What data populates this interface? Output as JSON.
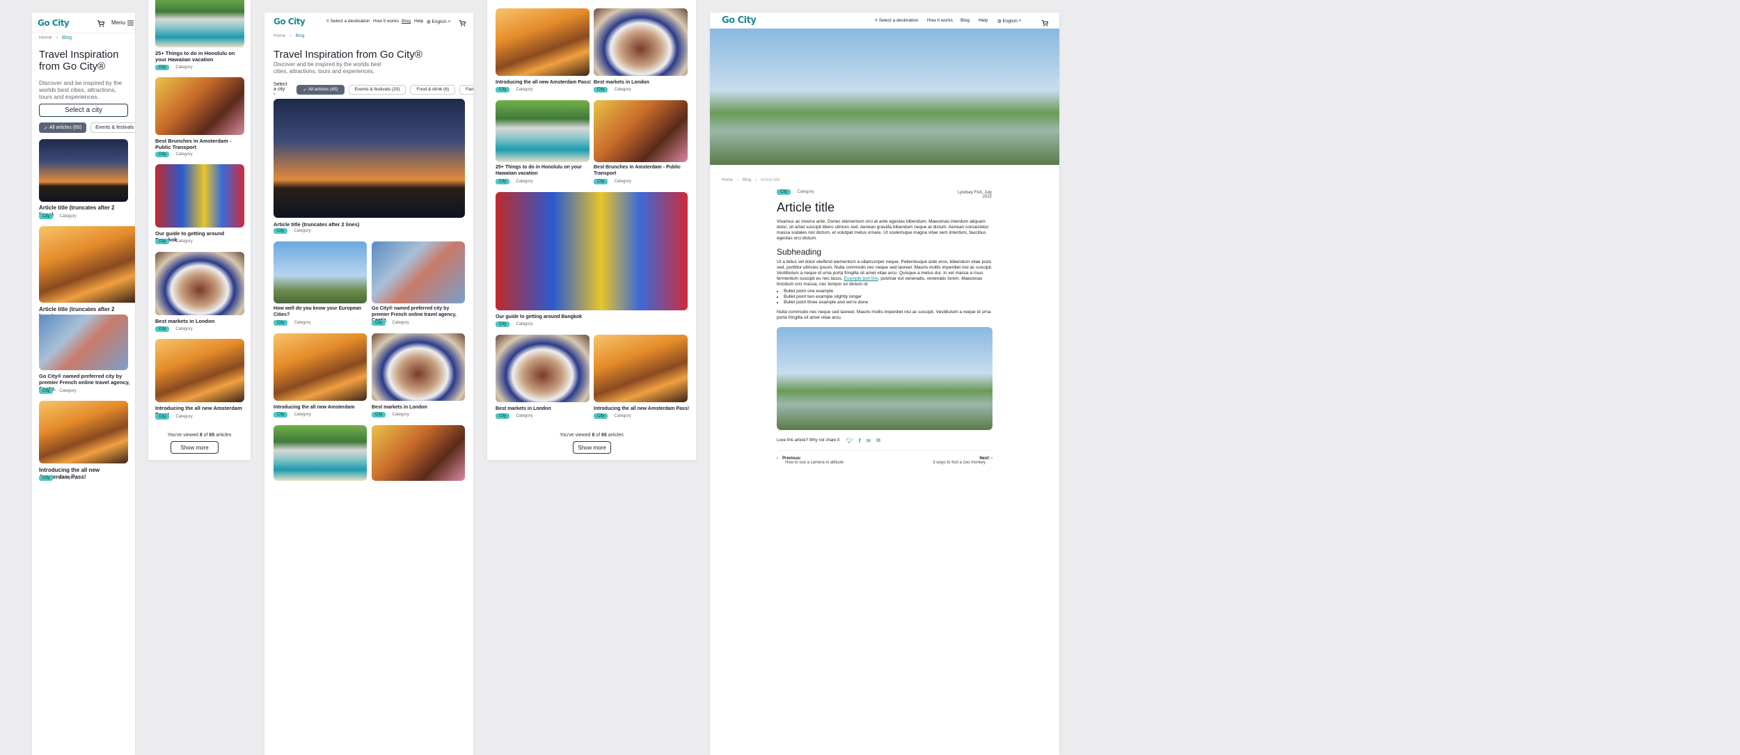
{
  "brand": "Go City",
  "nav": {
    "menu": "Menu",
    "destination": "Select a destination",
    "how": "How it works",
    "blog": "Blog",
    "help": "Help",
    "lang": "English"
  },
  "crumb": {
    "home": "Home",
    "blog": "Blog",
    "article": "Article title"
  },
  "listing": {
    "title": "Travel Inspiration from Go City®",
    "subtitle": "Discover and be inspired by the worlds best cities, attractions, tours and experiences.",
    "select_city": "Select a city",
    "select_city_short": "Select a city"
  },
  "filters": {
    "all": "All articles (65)",
    "events": "Events & festivals (20)",
    "food": "Food & drink (6)",
    "family": "Family frie"
  },
  "tag": {
    "city": "City",
    "category": "Category"
  },
  "cards": {
    "article": "Article title (truncates after 2 lines)",
    "honolulu": "25+ Things to do in Honolulu on your Hawaiian vacation",
    "brunch": "Best Brunches in Amsterdam - Public Transport",
    "bangkok": "Our guide to getting around Bangkok",
    "london": "Best markets in London",
    "amsterdam": "Introducing the all new Amsterdam Pass!",
    "ceetiz": "Go City® named preferred city by premier French online travel agency, Ceetiz.",
    "european": "How well do you know your European Cities?"
  },
  "pager": {
    "pre": "You've viewed",
    "shown": "8",
    "of": "of",
    "total": "65",
    "post": "articles",
    "show_more": "Show more"
  },
  "article": {
    "author": "Lyndsey Fish, July 2022",
    "title": "Article title",
    "p1": "Vivamus ac viverra ante. Donec elementum orci at ante egestas bibendum. Maecenas interdum aliquam dolor, sit amet suscipit libero ultrices sed. Aenean gravida bibendum neque at dictum. Aenean consectetur massa sodales nisl dictum, et volutpat metus ornare. Ut scelerisque magna vitae sem interdum, faucibus egestas orci dictum.",
    "subheading": "Subheading",
    "p2a": "Ut a tellus vel dolor eleifend elementum a ullamcorper neque. Pellentesque ante eros, bibendum vitae justo sed, porttitor ultricies ipsum. Nulla commodo nec neque sed laoreet. Mauris mollis imperdiet nisl ac suscipit. Vestibulum a neque id urna porta fringilla sit amet vitae arcu. Quisque a metus dui. In vel massa a risus fermentum suscipit eu nec lacus.",
    "link": "Example text link",
    "p2b": ", pulvinar est venenatis, venenatis lorem. Maecenas tincidunt orci massa, nec tempor ex dictum id.",
    "bullets": [
      "Bullet point one example",
      "Bullet point two example slightly longer",
      "Bullet point three example and we're done"
    ],
    "p3": "Nulla commodo nec neque sed laoreet. Mauris mollis imperdiet nisl ac suscipit. Vestibulum a neque id urna porta fringilla sit amet vitae arcu.",
    "share": "Love this article? Why not share it:",
    "prev_label": "Previous:",
    "prev_title": "How to use a camera in altitude",
    "next_label": "Next:",
    "next_title": "3 ways to fool a zoo monkey"
  }
}
